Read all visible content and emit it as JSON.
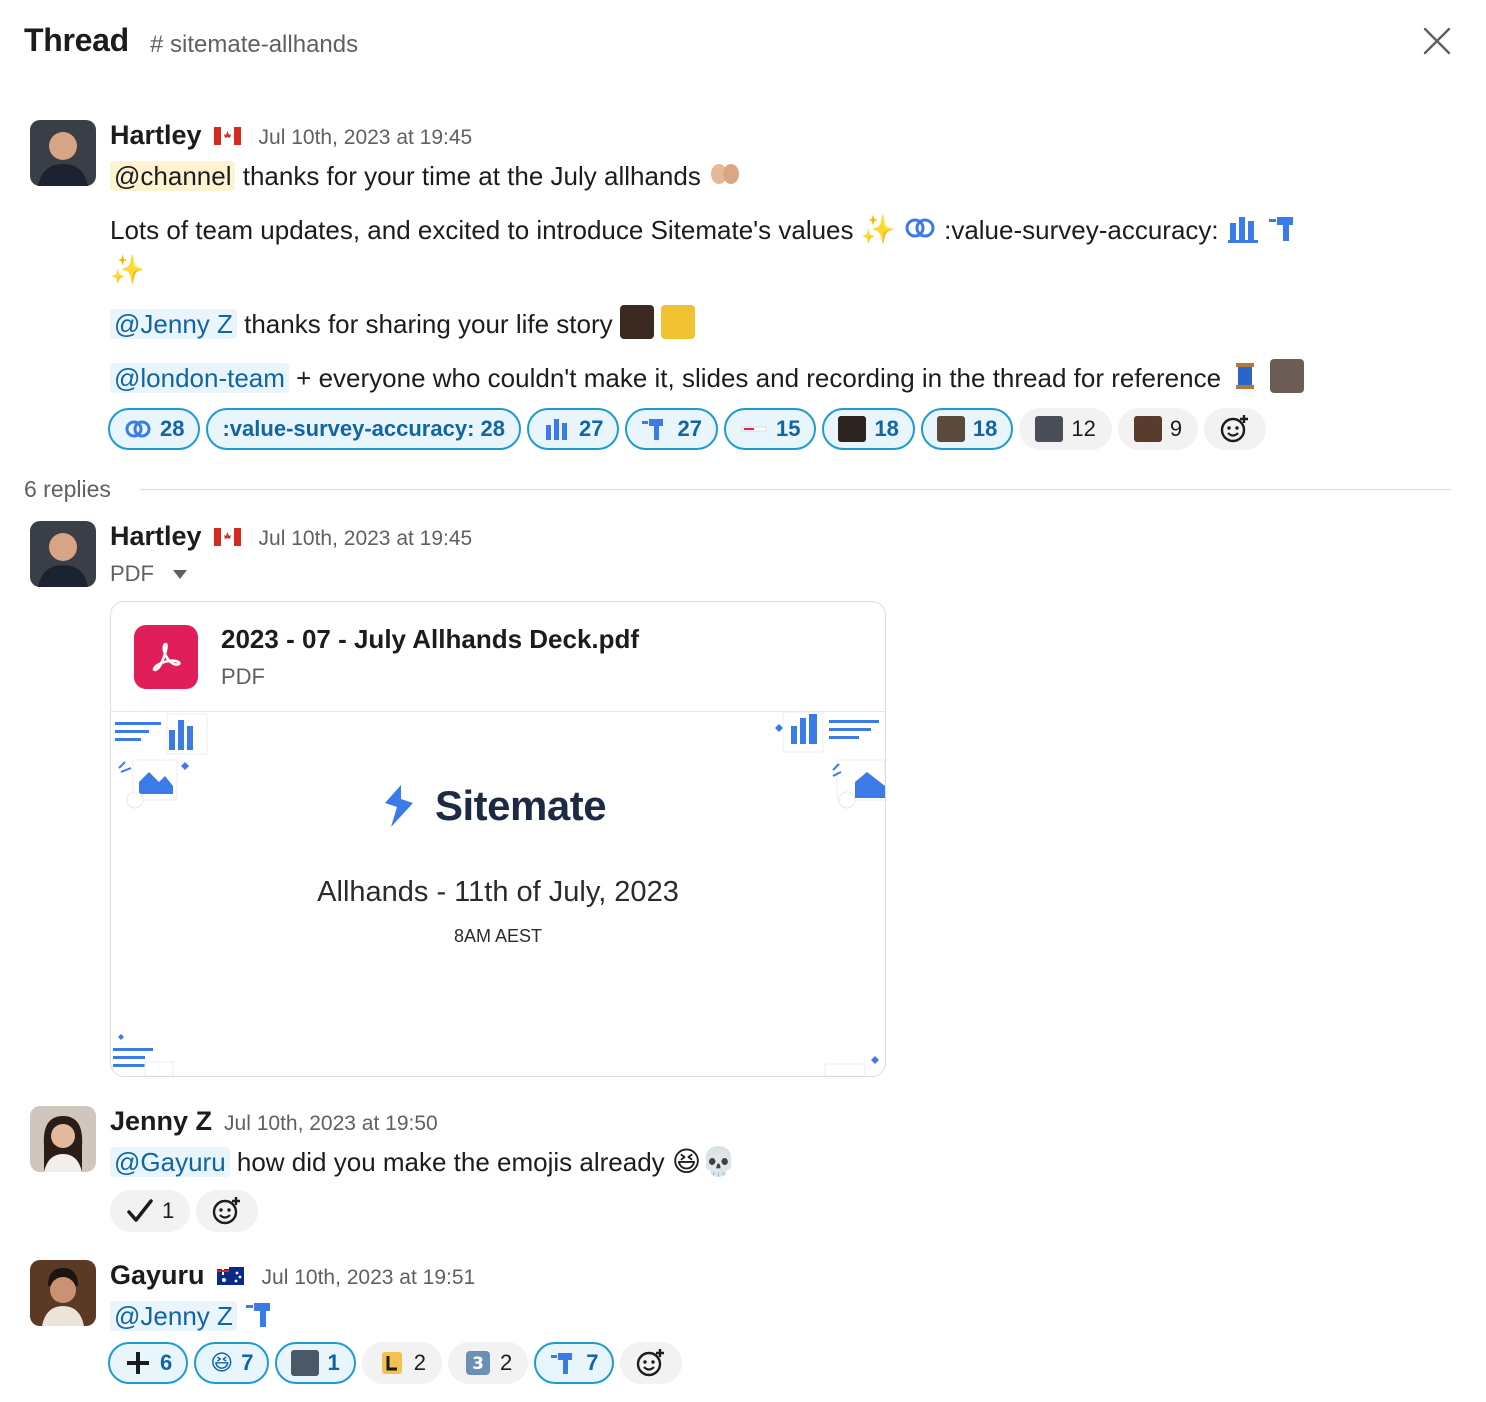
{
  "header": {
    "title": "Thread",
    "channel": "# sitemate-allhands"
  },
  "icons": {
    "close": "close-icon",
    "add_reaction": "add-reaction-icon",
    "pdf": "pdf-icon",
    "dropdown": "caret-down-icon"
  },
  "colors": {
    "accent": "#1264a3",
    "reaction_border": "#1d9bd1",
    "reaction_bg": "#e8f5fa",
    "pdf_red": "#e01e5a",
    "sitemate_blue": "#3b7be8"
  },
  "parent": {
    "author": "Hartley",
    "time": "Jul 10th, 2023 at 19:45",
    "line1": {
      "mention": "@channel",
      "text": "thanks for your time at the July allhands"
    },
    "line2": {
      "text": "Lots of team updates, and excited to introduce Sitemate's values",
      "shortcode": ":value-survey-accuracy:"
    },
    "line3": {
      "mention": "@Jenny Z",
      "text": "thanks for sharing your life story"
    },
    "line4": {
      "mention": "@london-team",
      "text": "+ everyone who couldn't make it, slides and recording in the thread for reference"
    },
    "reactions": [
      {
        "label": "28",
        "emoji": "value-collab",
        "active": true
      },
      {
        "label": ":value-survey-accuracy: 28",
        "emoji": "",
        "active": true
      },
      {
        "label": "27",
        "emoji": "value-building",
        "active": true
      },
      {
        "label": "27",
        "emoji": "value-drill",
        "active": true
      },
      {
        "label": "15",
        "emoji": "value-line",
        "active": true
      },
      {
        "label": "18",
        "emoji": "photo-a",
        "active": true
      },
      {
        "label": "18",
        "emoji": "photo-b",
        "active": true
      },
      {
        "label": "12",
        "emoji": "photo-c",
        "active": false
      },
      {
        "label": "9",
        "emoji": "photo-d",
        "active": false
      }
    ]
  },
  "replies_label": "6 replies",
  "reply1": {
    "author": "Hartley",
    "time": "Jul 10th, 2023 at 19:45",
    "attachment_label": "PDF",
    "file": {
      "name": "2023 - 07 - July Allhands Deck.pdf",
      "type": "PDF",
      "preview_brand": "Sitemate",
      "preview_title": "Allhands - 11th of July, 2023",
      "preview_subtitle": "8AM AEST"
    }
  },
  "reply2": {
    "author": "Jenny Z",
    "time": "Jul 10th, 2023 at 19:50",
    "mention": "@Gayuru",
    "text": "how did you make the emojis already",
    "reactions": [
      {
        "label": "1",
        "emoji": "check-mark",
        "active": false
      }
    ]
  },
  "reply3": {
    "author": "Gayuru",
    "time": "Jul 10th, 2023 at 19:51",
    "mention": "@Jenny Z",
    "reactions": [
      {
        "label": "6",
        "emoji": "plus",
        "active": true
      },
      {
        "label": "7",
        "emoji": "laughing",
        "active": true
      },
      {
        "label": "1",
        "emoji": "photo-e",
        "active": true
      },
      {
        "label": "2",
        "emoji": "letter-l",
        "active": false
      },
      {
        "label": "2",
        "emoji": "keycap-3",
        "active": false
      },
      {
        "label": "7",
        "emoji": "value-drill",
        "active": true
      }
    ]
  }
}
